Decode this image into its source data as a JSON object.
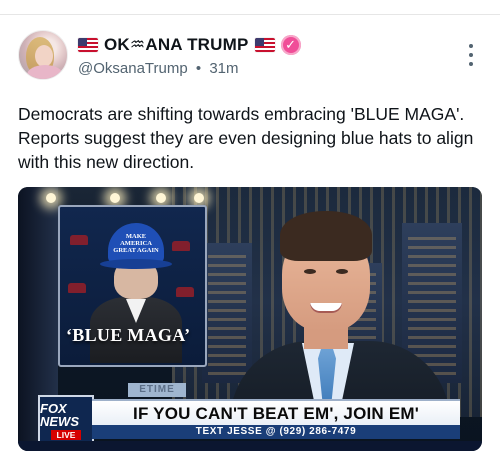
{
  "post": {
    "display_name": "OK♒ANA TRUMP",
    "handle": "@OksanaTrump",
    "time": "31m",
    "text": "Democrats are shifting towards embracing 'BLUE MAGA'. Reports suggest they are even designing blue hats to align with this new direction."
  },
  "media": {
    "hat_text": "MAKE AMERICA GREAT AGAIN",
    "panel_caption": "‘BLUE MAGA’",
    "chyron_tag": "ETIME",
    "network_logo": "FOX NEWS",
    "live_label": "LIVE",
    "headline": "IF YOU CAN'T BEAT EM', JOIN EM'",
    "subline": "TEXT JESSE @ (929) 286-7479"
  },
  "colors": {
    "verified_badge": "#f04e98",
    "hat_blue": "#1f4fb6",
    "fox_navy": "#0f2750",
    "live_red": "#d60000"
  },
  "icons": [
    "us-flag-icon",
    "verified-badge-icon",
    "more-options-icon"
  ]
}
